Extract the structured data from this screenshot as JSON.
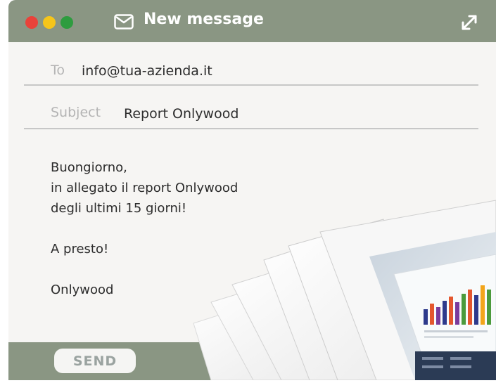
{
  "window": {
    "title": "New message",
    "controls": [
      "close",
      "minimize",
      "maximize"
    ],
    "colors": {
      "titlebar": "#8a9683",
      "close": "#e9423a",
      "minimize": "#f5c51a",
      "maximize": "#2e9c3f"
    }
  },
  "fields": {
    "to": {
      "label": "To",
      "value": "info@tua-azienda.it"
    },
    "subject": {
      "label": "Subject",
      "value": "Report Onlywood"
    }
  },
  "message": {
    "greeting": "Buongiorno,",
    "line1": "in allegato il report Onlywood",
    "line2": "degli ultimi 15 giorni!",
    "closing": "A presto!",
    "signature": "Onlywood"
  },
  "footer": {
    "send_label": "SEND"
  },
  "icons": {
    "title": "mail-icon",
    "expand": "expand-icon",
    "attachment": "report-pages-image"
  }
}
